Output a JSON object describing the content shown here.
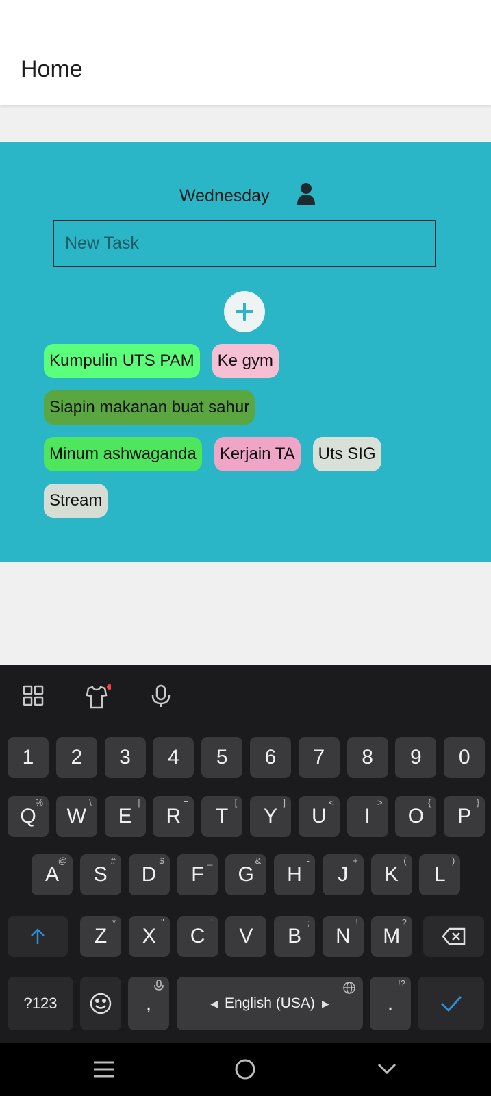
{
  "app": {
    "title": "Home"
  },
  "panel": {
    "day": "Wednesday",
    "input_placeholder": "New Task",
    "tasks": [
      {
        "label": "Kumpulin UTS PAM",
        "color": "#5cff7c"
      },
      {
        "label": "Ke gym",
        "color": "#f7bfd3"
      },
      {
        "label": "Siapin makanan buat sahur",
        "color": "#5aa742"
      },
      {
        "label": "Minum ashwaganda",
        "color": "#4ee65c"
      },
      {
        "label": "Kerjain TA",
        "color": "#efa6c6"
      },
      {
        "label": "Uts SIG",
        "color": "#d8e0d8"
      },
      {
        "label": "Stream",
        "color": "#d5ddd4"
      }
    ]
  },
  "keyboard": {
    "number_row": [
      "1",
      "2",
      "3",
      "4",
      "5",
      "6",
      "7",
      "8",
      "9",
      "0"
    ],
    "row1": [
      {
        "k": "Q",
        "h": "%"
      },
      {
        "k": "W",
        "h": "\\"
      },
      {
        "k": "E",
        "h": "|"
      },
      {
        "k": "R",
        "h": "="
      },
      {
        "k": "T",
        "h": "["
      },
      {
        "k": "Y",
        "h": "]"
      },
      {
        "k": "U",
        "h": "<"
      },
      {
        "k": "I",
        "h": ">"
      },
      {
        "k": "O",
        "h": "{"
      },
      {
        "k": "P",
        "h": "}"
      }
    ],
    "row2": [
      {
        "k": "A",
        "h": "@"
      },
      {
        "k": "S",
        "h": "#"
      },
      {
        "k": "D",
        "h": "$"
      },
      {
        "k": "F",
        "h": "_"
      },
      {
        "k": "G",
        "h": "&"
      },
      {
        "k": "H",
        "h": "-"
      },
      {
        "k": "J",
        "h": "+"
      },
      {
        "k": "K",
        "h": "("
      },
      {
        "k": "L",
        "h": ")"
      }
    ],
    "row3": [
      {
        "k": "Z",
        "h": "*"
      },
      {
        "k": "X",
        "h": "\""
      },
      {
        "k": "C",
        "h": "'"
      },
      {
        "k": "V",
        "h": ":"
      },
      {
        "k": "B",
        "h": ";"
      },
      {
        "k": "N",
        "h": "!"
      },
      {
        "k": "M",
        "h": "?"
      }
    ],
    "symbols_label": "?123",
    "comma_label": ",",
    "space_label": "English (USA)",
    "period_label": ".",
    "period_hint": "!?",
    "accent_color": "#2d8fd5"
  },
  "icons": {
    "user": "user-icon",
    "add": "plus-icon",
    "grid": "grid-icon",
    "theme": "shirt-icon",
    "mic": "mic-icon",
    "shift": "shift-arrow-icon",
    "backspace": "backspace-icon",
    "emoji": "emoji-icon",
    "globe": "globe-icon",
    "check": "check-icon",
    "nav_menu": "menu-icon",
    "nav_home": "home-circle-icon",
    "nav_back": "chevron-down-icon"
  }
}
